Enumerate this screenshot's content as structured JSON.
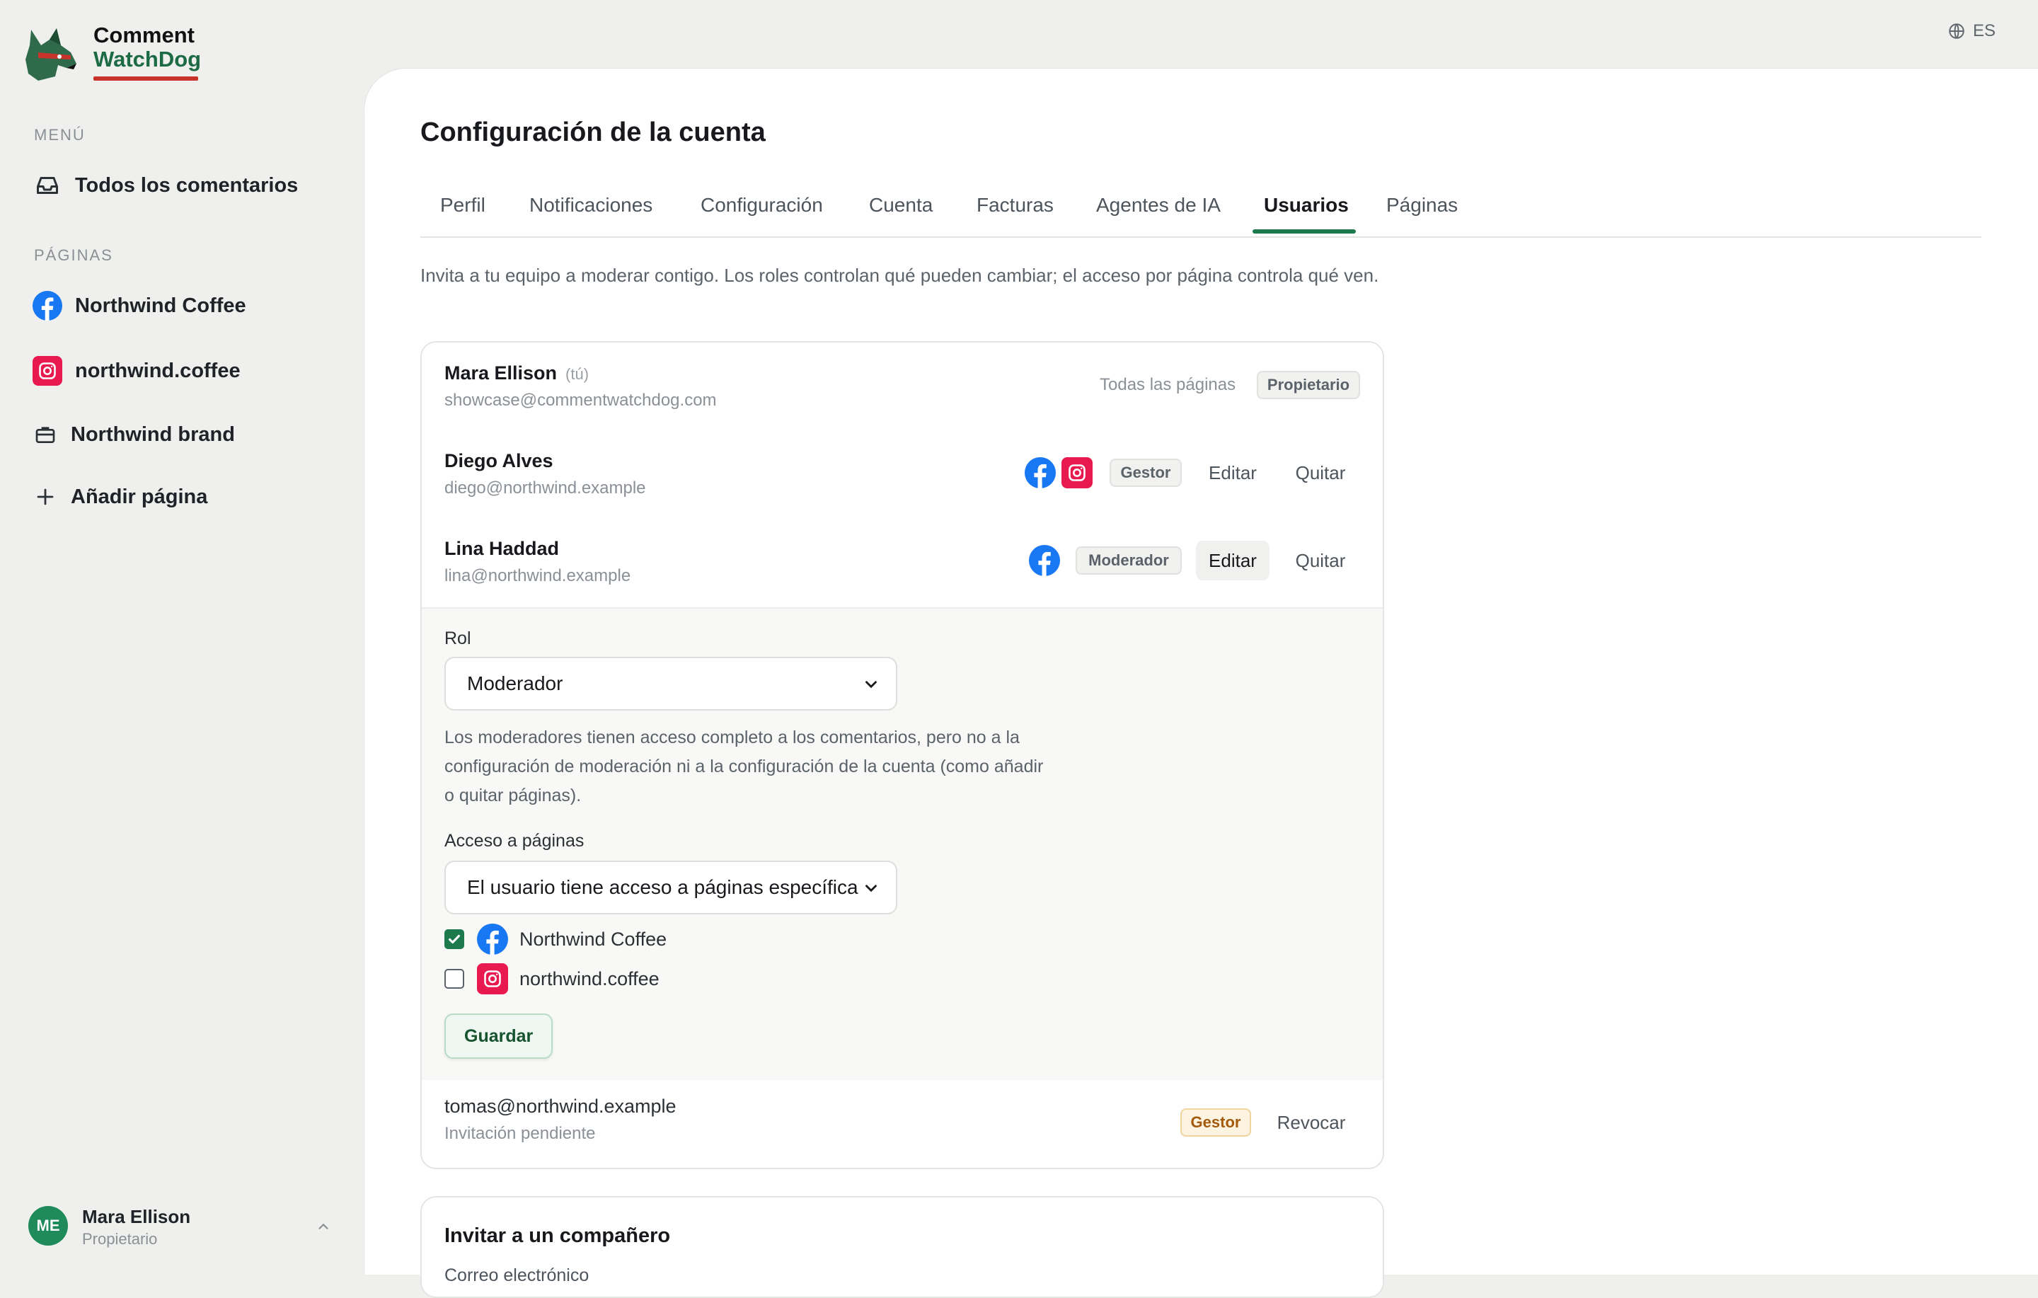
{
  "brand": {
    "line1": "Comment",
    "line2": "WatchDog"
  },
  "language": {
    "code": "ES"
  },
  "sidebar": {
    "menu_label": "MENÚ",
    "all_comments": "Todos los comentarios",
    "pages_label": "PÁGINAS",
    "pages": [
      {
        "label": "Northwind Coffee",
        "icon": "facebook-icon"
      },
      {
        "label": "northwind.coffee",
        "icon": "instagram-icon"
      },
      {
        "label": "Northwind brand",
        "icon": "briefcase-icon"
      }
    ],
    "add_page": "Añadir página"
  },
  "current_user": {
    "initials": "ME",
    "name": "Mara Ellison",
    "role": "Propietario"
  },
  "page": {
    "title": "Configuración de la cuenta",
    "tabs": [
      "Perfil",
      "Notificaciones",
      "Configuración",
      "Cuenta",
      "Facturas",
      "Agentes de IA",
      "Usuarios",
      "Páginas"
    ],
    "active_tab": "Usuarios",
    "intro": "Invita a tu equipo a moderar contigo. Los roles controlan qué pueden cambiar; el acceso por página controla qué ven."
  },
  "users": [
    {
      "name": "Mara Ellison",
      "you": "(tú)",
      "email": "showcase@commentwatchdog.com",
      "scope": "Todas las páginas",
      "role": "Propietario"
    },
    {
      "name": "Diego Alves",
      "email": "diego@northwind.example",
      "role": "Gestor",
      "edit": "Editar",
      "remove": "Quitar",
      "pages": [
        "facebook-icon",
        "instagram-icon"
      ]
    },
    {
      "name": "Lina Haddad",
      "email": "lina@northwind.example",
      "role": "Moderador",
      "edit": "Editar",
      "remove": "Quitar",
      "pages": [
        "facebook-icon"
      ]
    }
  ],
  "editor": {
    "role_label": "Rol",
    "role_value": "Moderador",
    "role_help": "Los moderadores tienen acceso completo a los comentarios, pero no a la configuración de moderación ni a la configuración de la cuenta (como añadir o quitar páginas).",
    "access_label": "Acceso a páginas",
    "access_value": "El usuario tiene acceso a páginas específica",
    "page_options": [
      {
        "label": "Northwind Coffee",
        "checked": true,
        "icon": "facebook-icon"
      },
      {
        "label": "northwind.coffee",
        "checked": false,
        "icon": "instagram-icon"
      }
    ],
    "save": "Guardar"
  },
  "pending": {
    "email": "tomas@northwind.example",
    "status": "Invitación pendiente",
    "role": "Gestor",
    "revoke": "Revocar"
  },
  "invite": {
    "title": "Invitar a un compañero",
    "sub": "Correo electrónico"
  },
  "colors": {
    "accent": "#1c7a4d",
    "facebook": "#1877f2",
    "instagram": "#e8194e",
    "warning": "#a35a0a"
  }
}
